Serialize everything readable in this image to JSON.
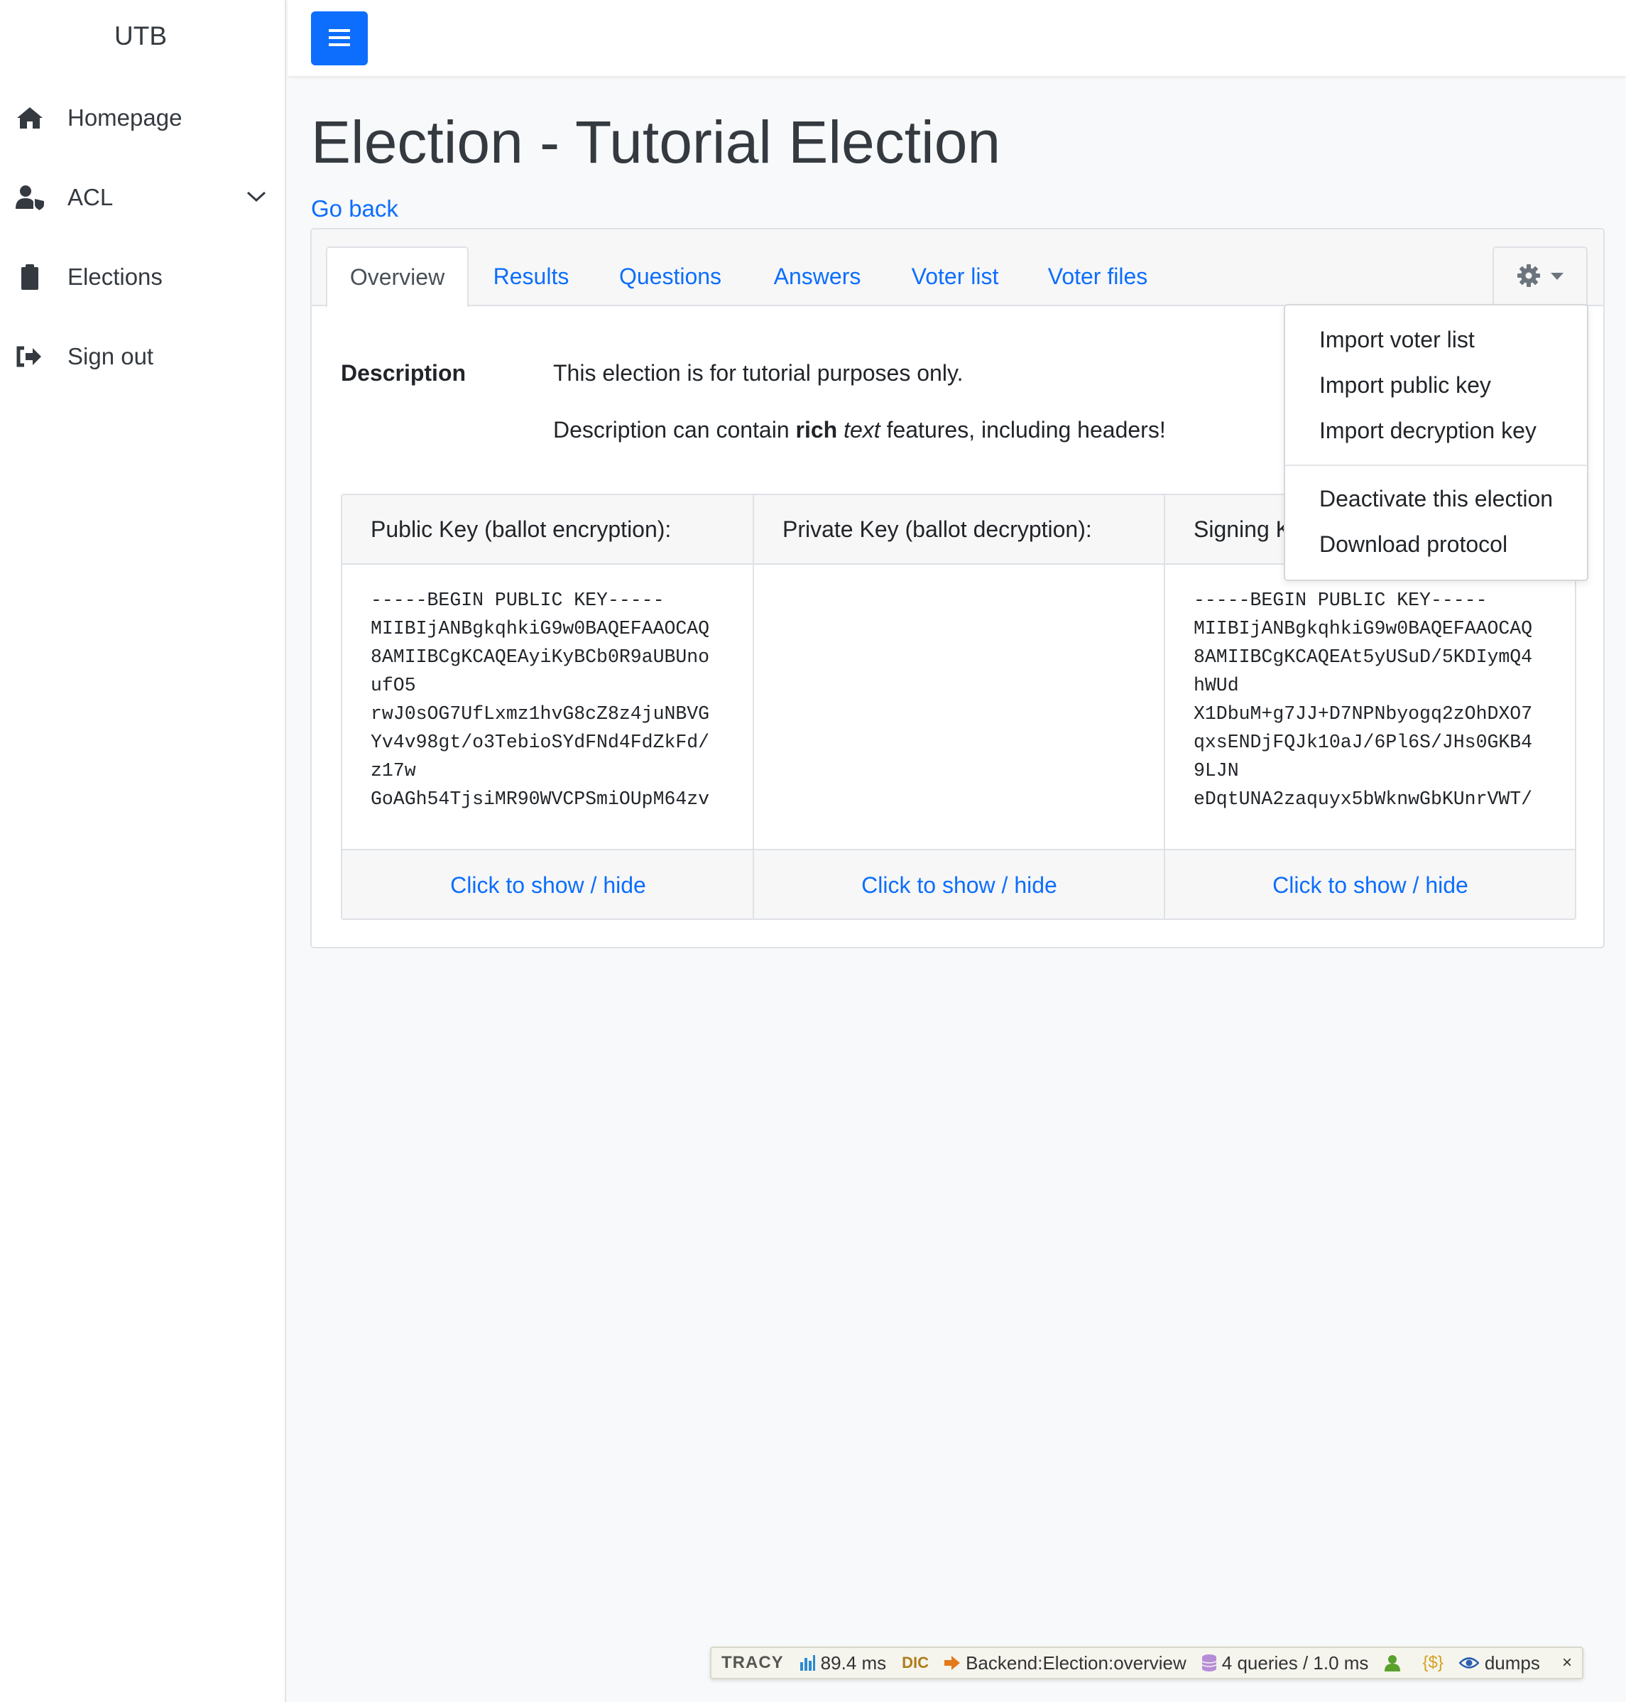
{
  "sidebar": {
    "brand": "UTB",
    "items": [
      {
        "label": "Homepage",
        "icon": "home-icon"
      },
      {
        "label": "ACL",
        "icon": "user-shield-icon"
      },
      {
        "label": "Elections",
        "icon": "clipboard-icon"
      },
      {
        "label": "Sign out",
        "icon": "sign-out-icon"
      }
    ]
  },
  "topbar": {
    "menu_icon": "hamburger-icon"
  },
  "page": {
    "title": "Election - Tutorial Election",
    "back_link": "Go back"
  },
  "tabs": [
    {
      "label": "Overview",
      "active": true
    },
    {
      "label": "Results"
    },
    {
      "label": "Questions"
    },
    {
      "label": "Answers"
    },
    {
      "label": "Voter list"
    },
    {
      "label": "Voter files"
    }
  ],
  "gear_menu": {
    "icon": "gear-icon",
    "items": [
      "Import voter list",
      "Import public key",
      "Import decryption key",
      "Deactivate this election",
      "Download protocol"
    ]
  },
  "description": {
    "label": "Description",
    "line1": "This election is for tutorial purposes only.",
    "line2_before": "Description can contain ",
    "line2_bold": "rich",
    "line2_italic": "text",
    "line2_after": " features, including headers!"
  },
  "keys": [
    {
      "header": "Public Key (ballot encryption):",
      "content": "-----BEGIN PUBLIC KEY-----\nMIIBIjANBgkqhkiG9w0BAQEFAAOCAQ\n8AMIIBCgKCAQEAyiKyBCb0R9aUBUno\nufO5\nrwJ0sOG7UfLxmz1hvG8cZ8z4juNBVG\nYv4v98gt/o3TebioSYdFNd4FdZkFd/\nz17w\nGoAGh54TjsiMR90WVCPSmiOUpM64zv",
      "toggle": "Click to show / hide"
    },
    {
      "header": "Private Key (ballot decryption):",
      "content": "",
      "toggle": "Click to show / hide"
    },
    {
      "header": "Signing K",
      "content": "-----BEGIN PUBLIC KEY-----\nMIIBIjANBgkqhkiG9w0BAQEFAAOCAQ\n8AMIIBCgKCAQEAt5yUSuD/5KDIymQ4\nhWUd\nX1DbuM+g7JJ+D7NPNbyogq2zOhDXO7\nqxsENDjFQJk10aJ/6Pl6S/JHs0GKB4\n9LJN\neDqtUNA2zaquyx5bWknwGbKUnrVWT/",
      "toggle": "Click to show / hide"
    }
  ],
  "tracy": {
    "logo": "TRACY",
    "time": "89.4 ms",
    "di": "DIC",
    "presenter": "Backend:Election:overview",
    "queries": "4 queries / 1.0 ms",
    "session": "{$}",
    "dumps": "dumps",
    "close": "×"
  },
  "colors": {
    "primary": "#0d6efd",
    "text": "#212529",
    "muted": "#495057"
  }
}
